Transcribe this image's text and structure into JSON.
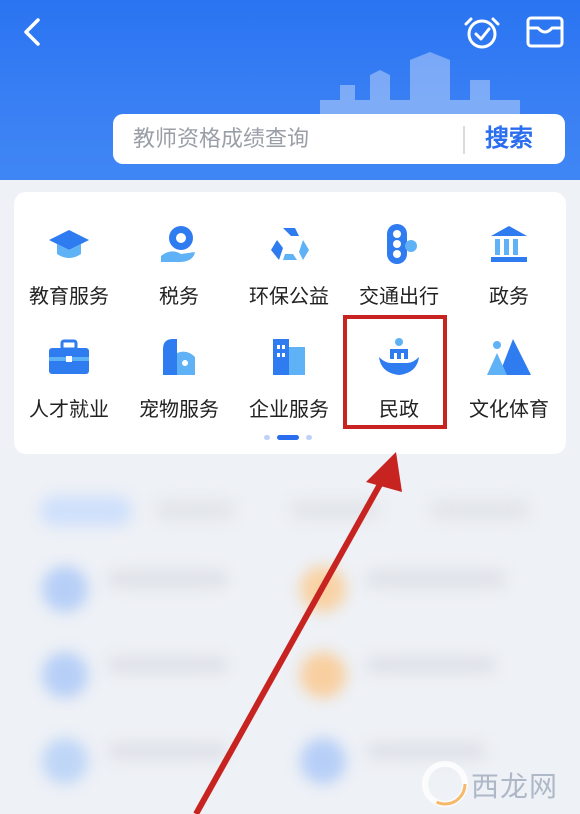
{
  "header": {
    "search": {
      "placeholder": "教师资格成绩查询",
      "button_label": "搜索"
    }
  },
  "services": [
    {
      "label": "教育服务",
      "icon": "graduation-cap-icon"
    },
    {
      "label": "税务",
      "icon": "tax-coin-icon"
    },
    {
      "label": "环保公益",
      "icon": "recycle-icon"
    },
    {
      "label": "交通出行",
      "icon": "traffic-light-icon"
    },
    {
      "label": "政务",
      "icon": "government-building-icon"
    },
    {
      "label": "人才就业",
      "icon": "briefcase-icon"
    },
    {
      "label": "宠物服务",
      "icon": "pet-icon"
    },
    {
      "label": "企业服务",
      "icon": "office-building-icon"
    },
    {
      "label": "民政",
      "icon": "civil-affairs-hands-icon"
    },
    {
      "label": "文化体育",
      "icon": "culture-sports-icon"
    }
  ],
  "pager": {
    "count": 3,
    "active_index": 1
  },
  "annotation": {
    "highlighted_item": "民政",
    "color": "#c72320"
  },
  "watermark": {
    "text": "西龙网"
  },
  "colors": {
    "accent": "#2a6ef0",
    "header_bg": "#3a80f4",
    "icon_blue": "#2f7bf0",
    "icon_light": "#5fb2f5"
  }
}
